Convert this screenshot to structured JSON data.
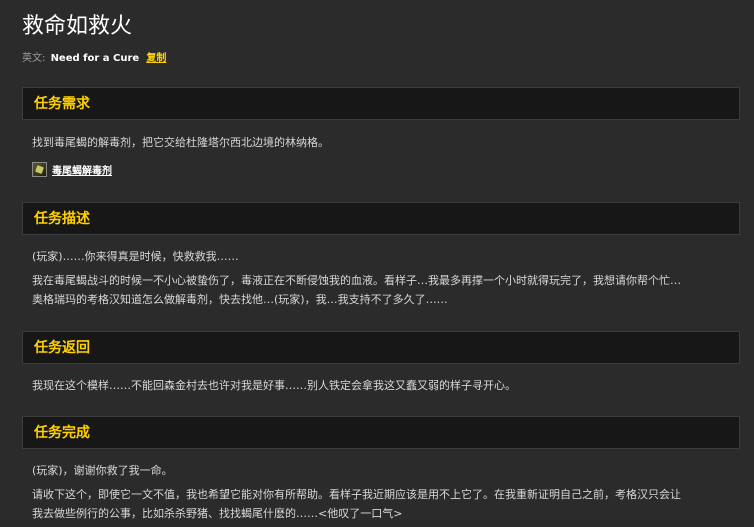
{
  "quest": {
    "title": "救命如救火",
    "english_label": "英文:",
    "english_name": "Need for a Cure",
    "copy_label": "复制"
  },
  "sections": {
    "requirements": {
      "header": "任务需求",
      "text": "找到毒尾蝎的解毒剂，把它交给杜隆塔尔西北边境的林纳格。",
      "item": {
        "icon": "potion-icon",
        "label": "毒尾蝎解毒剂"
      }
    },
    "description": {
      "header": "任务描述",
      "lines": [
        "(玩家)……你来得真是时候，快救救我……",
        "我在毒尾蝎战斗的时候一不小心被蛰伤了，毒液正在不断侵蚀我的血液。看样子…我最多再撑一个小时就得玩完了，我想请你帮个忙…",
        "奥格瑞玛的考格汉知道怎么做解毒剂，快去找他…(玩家)，我…我支持不了多久了……"
      ]
    },
    "return": {
      "header": "任务返回",
      "text": "我现在这个模样……不能回森金村去也许对我是好事……别人铁定会拿我这又蠢又弱的样子寻开心。"
    },
    "completion": {
      "header": "任务完成",
      "lines": [
        "(玩家)，谢谢你救了我一命。",
        "请收下这个，即使它一文不值，我也希望它能对你有所帮助。看样子我近期应该是用不上它了。在我重新证明自己之前，考格汉只会让",
        "我去做些例行的公事，比如杀杀野猪、找找蝎尾什麽的……<他叹了一口气>"
      ]
    }
  },
  "colors": {
    "background": "#2b2b2b",
    "header_bg": "#171717",
    "accent": "#ffd100",
    "text": "#d8d8d8"
  }
}
